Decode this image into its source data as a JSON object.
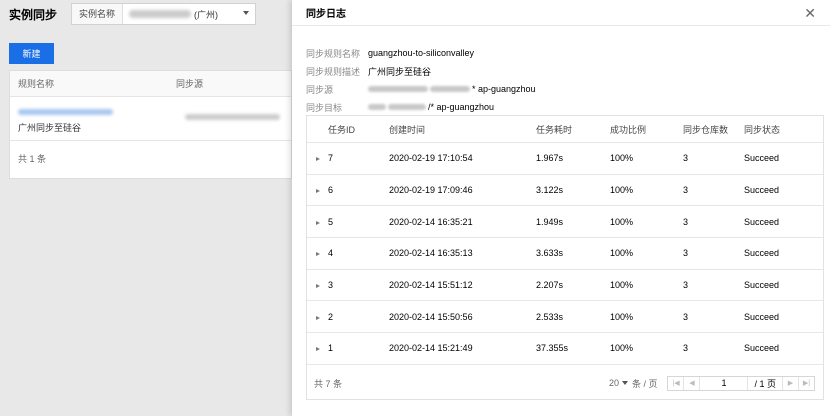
{
  "background": {
    "title": "实例同步",
    "instance_label": "实例名称",
    "instance_value_suffix": "(广州)",
    "new_button": "新建",
    "table": {
      "col_name": "规则名称",
      "col_source": "同步源",
      "row_desc": "广州同步至硅谷"
    },
    "total": "共 1 条"
  },
  "drawer": {
    "title": "同步日志",
    "info": {
      "rule_name_label": "同步规则名称",
      "rule_name": "guangzhou-to-siliconvalley",
      "rule_desc_label": "同步规则描述",
      "rule_desc": "广州同步至硅谷",
      "source_label": "同步源",
      "source_suffix": "* ap-guangzhou",
      "target_label": "同步目标",
      "target_suffix": "/* ap-guangzhou"
    },
    "table": {
      "headers": {
        "id": "任务ID",
        "time": "创建时间",
        "duration": "任务耗时",
        "rate": "成功比例",
        "repos": "同步仓库数",
        "status": "同步状态"
      },
      "rows": [
        {
          "id": "7",
          "time": "2020-02-19 17:10:54",
          "duration": "1.967s",
          "rate": "100%",
          "repos": "3",
          "status": "Succeed"
        },
        {
          "id": "6",
          "time": "2020-02-19 17:09:46",
          "duration": "3.122s",
          "rate": "100%",
          "repos": "3",
          "status": "Succeed"
        },
        {
          "id": "5",
          "time": "2020-02-14 16:35:21",
          "duration": "1.949s",
          "rate": "100%",
          "repos": "3",
          "status": "Succeed"
        },
        {
          "id": "4",
          "time": "2020-02-14 16:35:13",
          "duration": "3.633s",
          "rate": "100%",
          "repos": "3",
          "status": "Succeed"
        },
        {
          "id": "3",
          "time": "2020-02-14 15:51:12",
          "duration": "2.207s",
          "rate": "100%",
          "repos": "3",
          "status": "Succeed"
        },
        {
          "id": "2",
          "time": "2020-02-14 15:50:56",
          "duration": "2.533s",
          "rate": "100%",
          "repos": "3",
          "status": "Succeed"
        },
        {
          "id": "1",
          "time": "2020-02-14 15:21:49",
          "duration": "37.355s",
          "rate": "100%",
          "repos": "3",
          "status": "Succeed"
        }
      ],
      "total": "共 7 条",
      "page_size": "20",
      "page_size_unit": "条 / 页",
      "current_page": "1",
      "page_total": "/ 1 页"
    }
  }
}
